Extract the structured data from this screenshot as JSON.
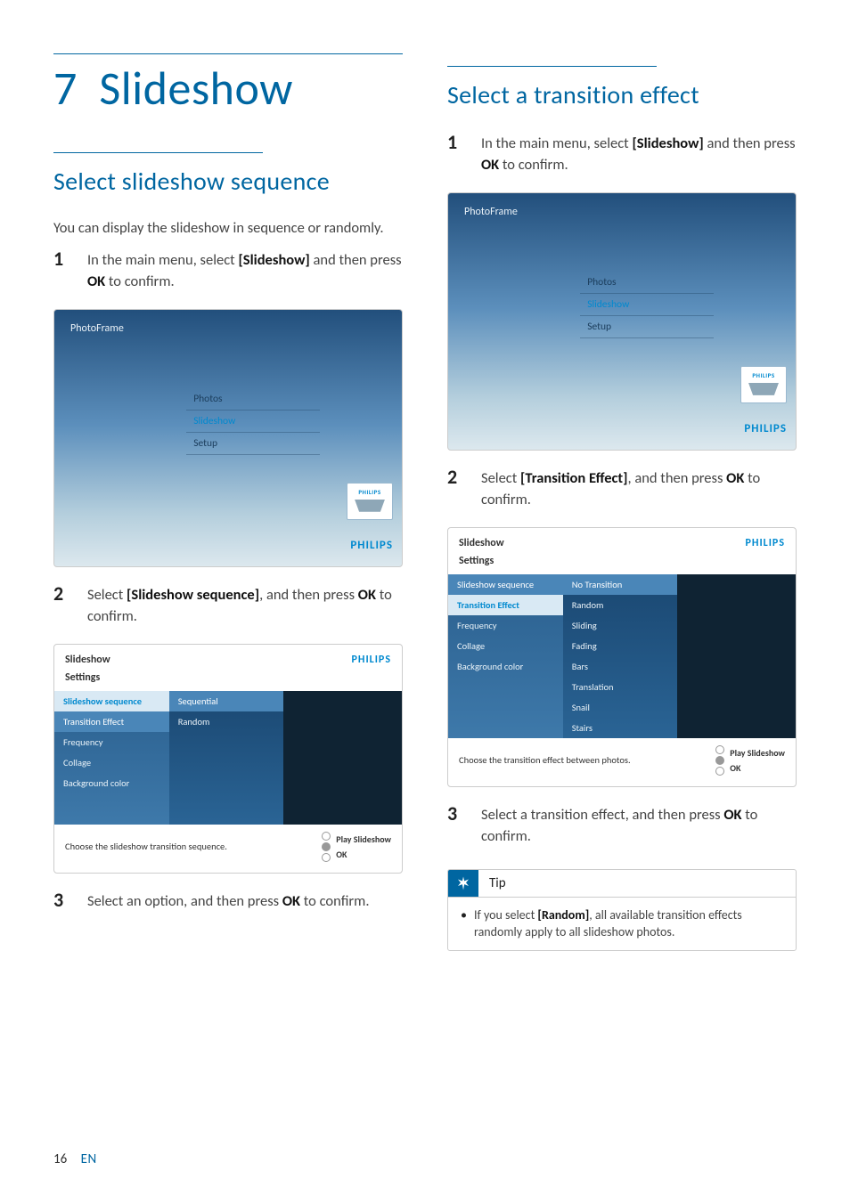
{
  "chapter": {
    "number": "7",
    "title": "Slideshow"
  },
  "left": {
    "section_title": "Select slideshow sequence",
    "intro": "You can display the slideshow in sequence or randomly.",
    "steps": {
      "s1": {
        "num": "1",
        "pre": "In the main menu, select ",
        "bold": "[Slideshow]",
        "mid": " and then press ",
        "bold2": "OK",
        "post": " to confirm."
      },
      "s2": {
        "num": "2",
        "pre": "Select ",
        "bold": "[Slideshow sequence]",
        "mid": ", and then press ",
        "bold2": "OK",
        "post": " to confirm."
      },
      "s3": {
        "num": "3",
        "pre": "Select an option, and then press ",
        "bold": "OK",
        "post": " to confirm."
      }
    },
    "ss_main": {
      "title": "PhotoFrame",
      "items": [
        "Photos",
        "Slideshow",
        "Setup"
      ],
      "badge": "PHILIPS",
      "brand": "PHILIPS"
    },
    "ss_set": {
      "head": "Slideshow",
      "brand": "PHILIPS",
      "sub": "Settings",
      "list": [
        "Slideshow sequence",
        "Transition Effect",
        "Frequency",
        "Collage",
        "Background color"
      ],
      "values": [
        "Sequential",
        "Random"
      ],
      "hint": "Choose the slideshow transition sequence.",
      "ctrl1": "Play Slideshow",
      "ctrl2": "OK"
    }
  },
  "right": {
    "section_title": "Select a transition effect",
    "steps": {
      "s1": {
        "num": "1",
        "pre": "In the main menu, select ",
        "bold": "[Slideshow]",
        "mid": " and then press ",
        "bold2": "OK",
        "post": " to confirm."
      },
      "s2": {
        "num": "2",
        "pre": "Select ",
        "bold": "[Transition Effect]",
        "mid": ", and then press ",
        "bold2": "OK",
        "post": " to confirm."
      },
      "s3": {
        "num": "3",
        "pre": "Select a transition effect, and then press ",
        "bold": "OK",
        "post": " to confirm."
      }
    },
    "ss_main": {
      "title": "PhotoFrame",
      "items": [
        "Photos",
        "Slideshow",
        "Setup"
      ],
      "badge": "PHILIPS",
      "brand": "PHILIPS"
    },
    "ss_set": {
      "head": "Slideshow",
      "brand": "PHILIPS",
      "sub": "Settings",
      "list": [
        "Slideshow sequence",
        "Transition Effect",
        "Frequency",
        "Collage",
        "Background color"
      ],
      "values": [
        "No Transition",
        "Random",
        "Sliding",
        "Fading",
        "Bars",
        "Translation",
        "Snail",
        "Stairs"
      ],
      "hint": "Choose the transition effect between photos.",
      "ctrl1": "Play Slideshow",
      "ctrl2": "OK"
    },
    "tip": {
      "label": "Tip",
      "text_pre": "If you select ",
      "text_bold": "[Random]",
      "text_post": ", all available transition effects randomly apply to all slideshow photos."
    }
  },
  "footer": {
    "page": "16",
    "lang": "EN"
  }
}
